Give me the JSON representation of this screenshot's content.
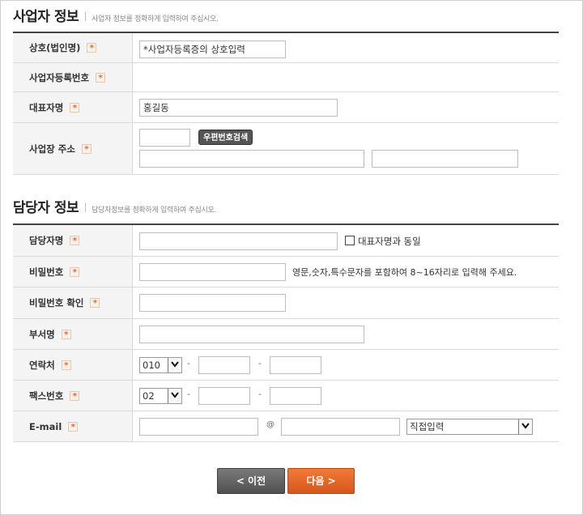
{
  "business": {
    "title": "사업자 정보",
    "desc": "사업자 정보를 정확하게 입력하여 주십시오.",
    "rows": {
      "name_label": "상호(법인명)",
      "name_value": "*사업자등록증의 상호입력",
      "regno_label": "사업자등록번호",
      "ceo_label": "대표자명",
      "ceo_value": "홍길동",
      "addr_label": "사업장 주소",
      "zip_button": "우편번호검색"
    }
  },
  "manager": {
    "title": "담당자 정보",
    "desc": "담당자정보를 정확하게 입력하여 주십시오.",
    "rows": {
      "manager_label": "담당자명",
      "same_as_ceo": "대표자명과 동일",
      "pw_label": "비밀번호",
      "pw_hint": "영문,숫자,특수문자를 포함하여 8~16자리로 입력해 주세요.",
      "pw_confirm_label": "비밀번호 확인",
      "dept_label": "부서명",
      "phone_label": "연락처",
      "phone_prefix": "010",
      "fax_label": "팩스번호",
      "fax_prefix": "02",
      "email_label": "E-mail",
      "at_sign": "@",
      "email_domain": "직접입력",
      "dash": "-"
    }
  },
  "required_mark": "*",
  "buttons": {
    "prev": "< 이전",
    "next": "다음 >"
  },
  "colors": {
    "accent": "#e2692a",
    "header_line": "#444444",
    "label_bg": "#f4f4f4"
  }
}
